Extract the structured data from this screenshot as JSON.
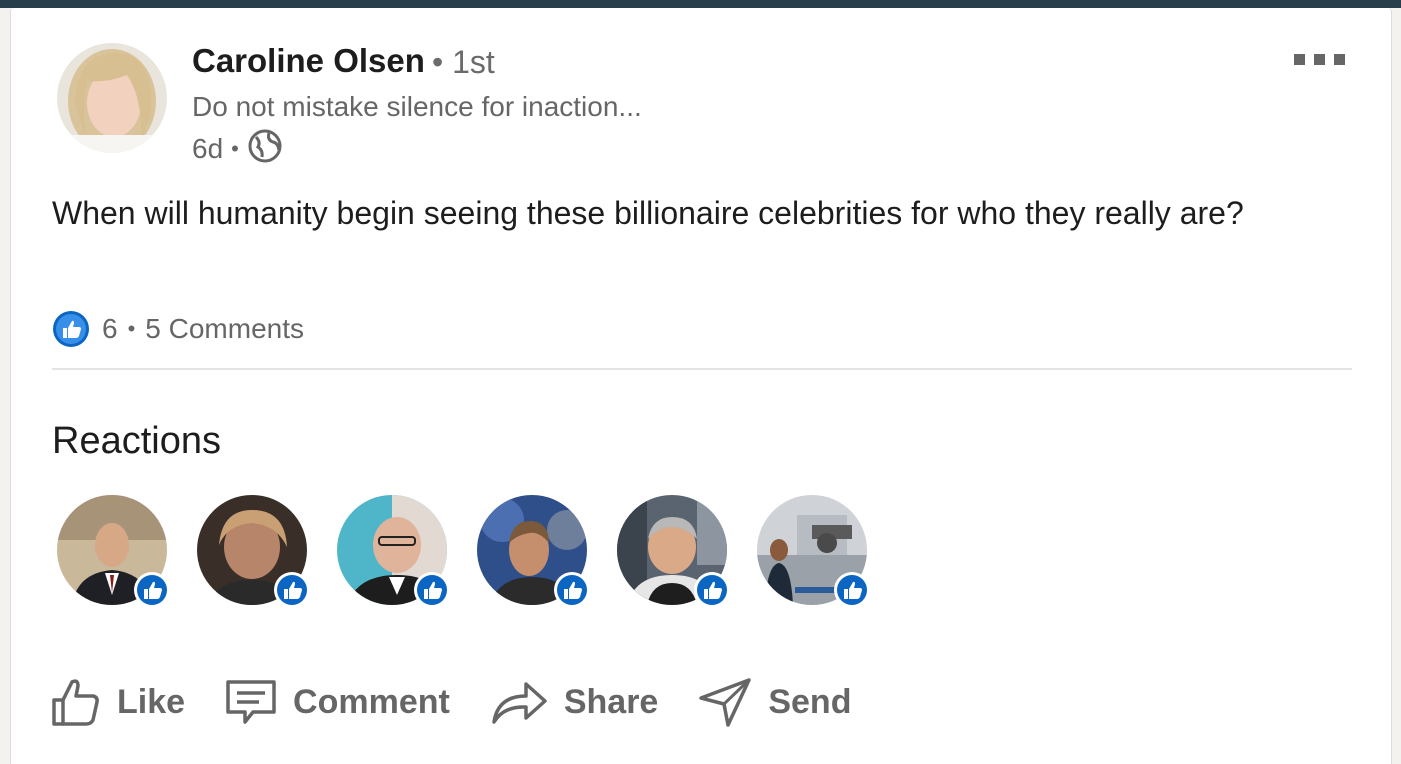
{
  "post": {
    "author": {
      "name": "Caroline Olsen",
      "degree": "• 1st",
      "headline": "Do not mistake silence for inaction...",
      "time": "6d",
      "visibility_icon": "globe-icon"
    },
    "text": "When will humanity begin seeing these billionaire celebrities for who they really are?",
    "reaction_count": "6",
    "comments": "5 Comments",
    "more_icon": "more-options-icon"
  },
  "reactions": {
    "title": "Reactions",
    "reactors": [
      {
        "reaction": "like-icon"
      },
      {
        "reaction": "like-icon"
      },
      {
        "reaction": "like-icon"
      },
      {
        "reaction": "like-icon"
      },
      {
        "reaction": "like-icon"
      },
      {
        "reaction": "like-icon"
      }
    ]
  },
  "actions": {
    "like": "Like",
    "comment": "Comment",
    "share": "Share",
    "send": "Send"
  },
  "colors": {
    "header_bar": "#283e4a",
    "like_blue": "#0a66c2",
    "muted_text": "#666666"
  }
}
